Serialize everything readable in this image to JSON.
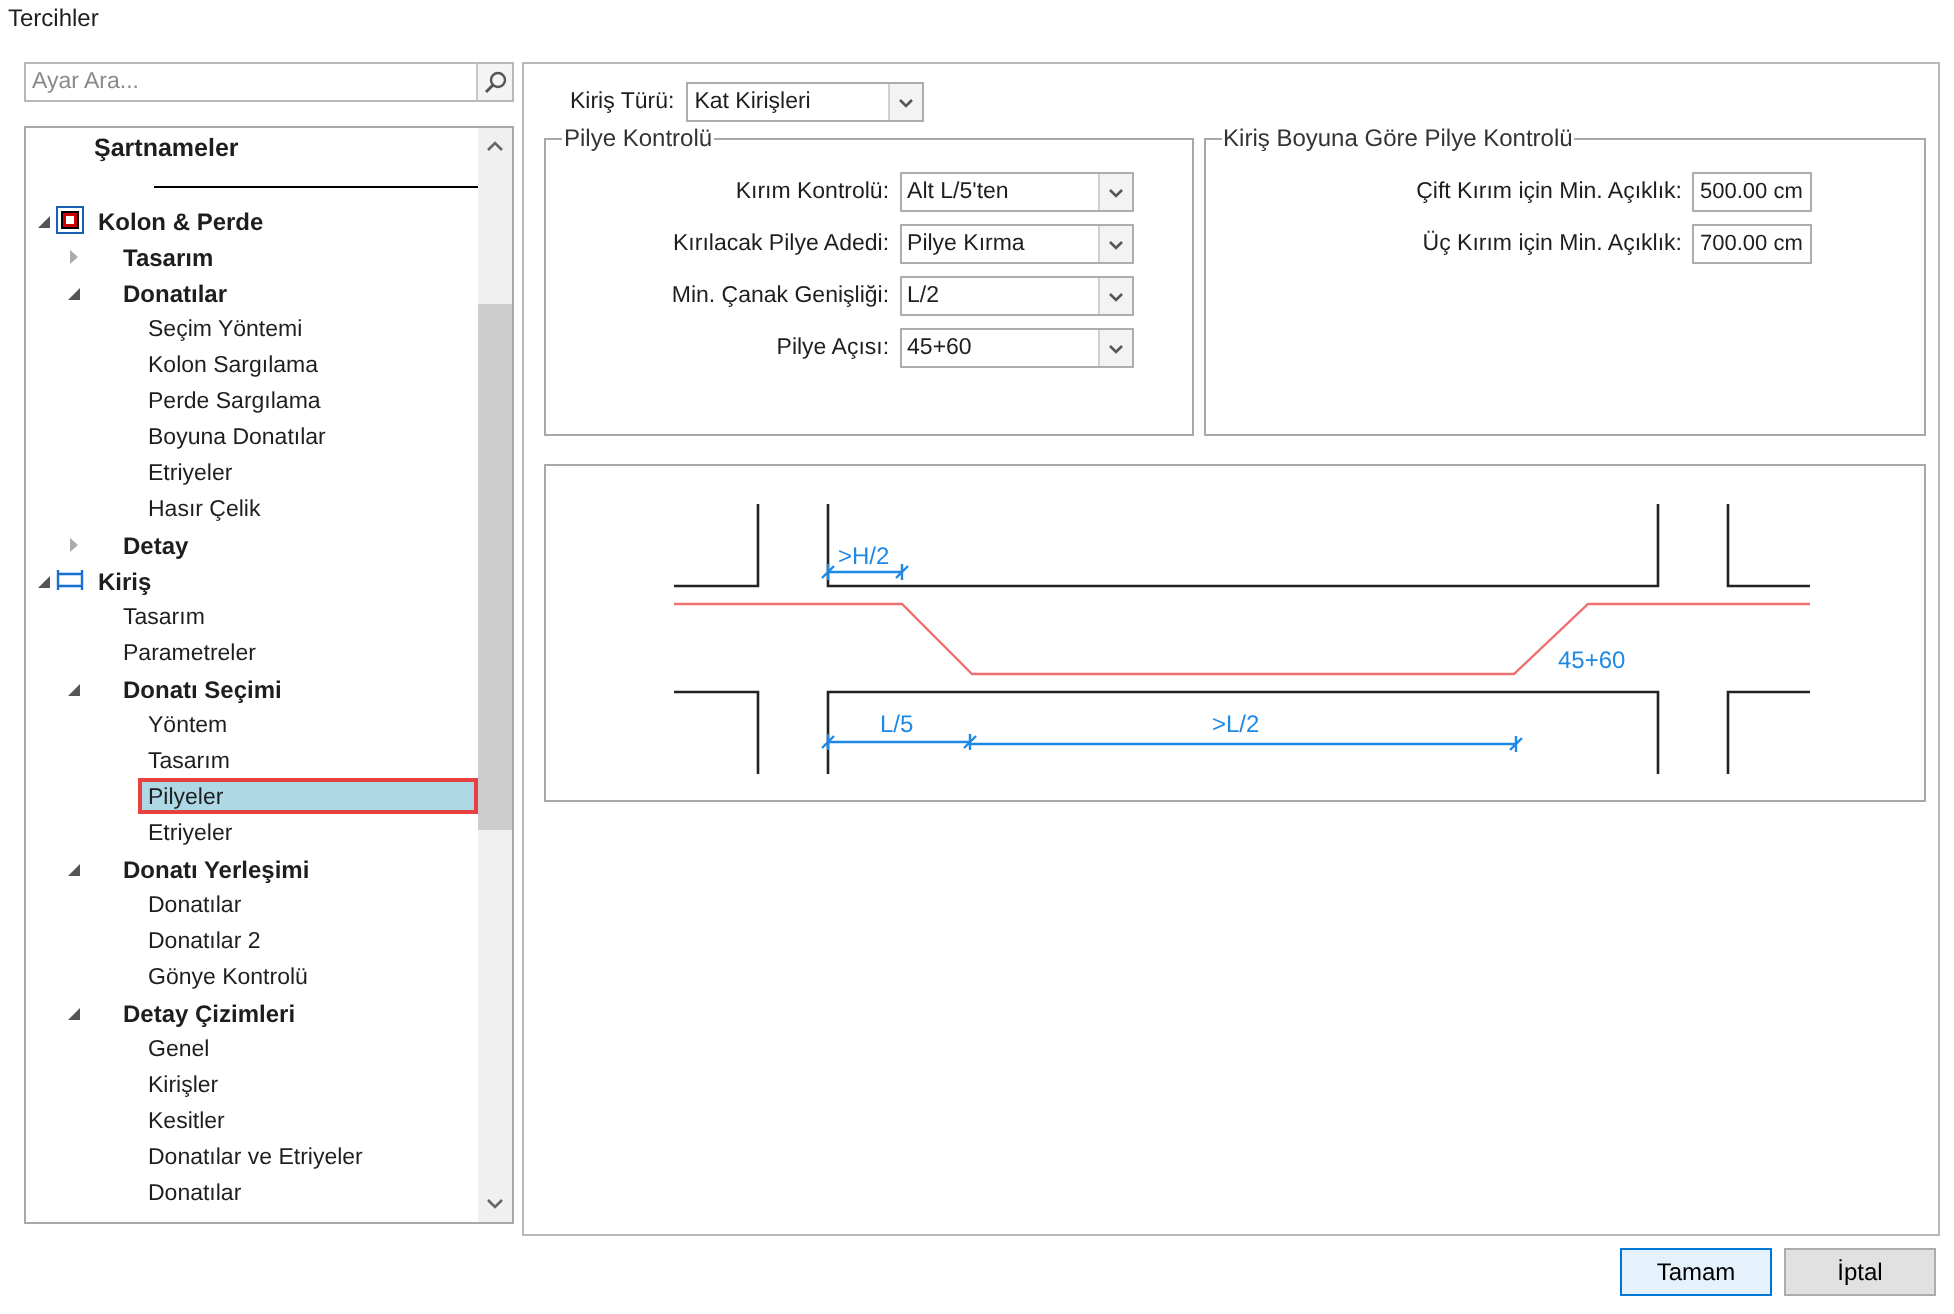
{
  "window": {
    "title": "Tercihler"
  },
  "search": {
    "placeholder": "Ayar Ara..."
  },
  "tree": {
    "header": "Şartnameler",
    "items": [
      {
        "label": "Kolon & Perde",
        "bold": true,
        "expanded": true,
        "kind": "column",
        "selected": false,
        "children": [
          {
            "label": "Tasarım",
            "bold": true,
            "expanded": false,
            "selected": false
          },
          {
            "label": "Donatılar",
            "bold": true,
            "expanded": true,
            "selected": false,
            "children": [
              {
                "label": "Seçim Yöntemi",
                "selected": false
              },
              {
                "label": "Kolon Sargılama",
                "selected": false
              },
              {
                "label": "Perde Sargılama",
                "selected": false
              },
              {
                "label": "Boyuna Donatılar",
                "selected": false
              },
              {
                "label": "Etriyeler",
                "selected": false
              },
              {
                "label": "Hasır Çelik",
                "selected": false
              }
            ]
          },
          {
            "label": "Detay",
            "bold": true,
            "expanded": false,
            "selected": false
          }
        ]
      },
      {
        "label": "Kiriş",
        "bold": true,
        "expanded": true,
        "kind": "beam",
        "selected": false,
        "children": [
          {
            "label": "Tasarım",
            "selected": false
          },
          {
            "label": "Parametreler",
            "selected": false
          },
          {
            "label": "Donatı Seçimi",
            "bold": true,
            "expanded": true,
            "selected": false,
            "children": [
              {
                "label": "Yöntem",
                "selected": false
              },
              {
                "label": "Tasarım",
                "selected": false
              },
              {
                "label": "Pilyeler",
                "selected": true
              },
              {
                "label": "Etriyeler",
                "selected": false
              }
            ]
          },
          {
            "label": "Donatı Yerleşimi",
            "bold": true,
            "expanded": true,
            "selected": false,
            "children": [
              {
                "label": "Donatılar",
                "selected": false
              },
              {
                "label": "Donatılar 2",
                "selected": false
              },
              {
                "label": "Gönye Kontrolü",
                "selected": false
              }
            ]
          },
          {
            "label": "Detay Çizimleri",
            "bold": true,
            "expanded": true,
            "selected": false,
            "children": [
              {
                "label": "Genel",
                "selected": false
              },
              {
                "label": "Kirişler",
                "selected": false
              },
              {
                "label": "Kesitler",
                "selected": false
              },
              {
                "label": "Donatılar ve Etriyeler",
                "selected": false
              },
              {
                "label": "Donatılar",
                "selected": false
              }
            ]
          }
        ]
      }
    ]
  },
  "beam_type": {
    "label": "Kiriş Türü:",
    "value": "Kat Kirişleri"
  },
  "pilye_control": {
    "title": "Pilye Kontrolü",
    "fields": [
      {
        "label": "Kırım Kontrolü:",
        "value": "Alt L/5'ten"
      },
      {
        "label": "Kırılacak Pilye Adedi:",
        "value": "Pilye Kırma"
      },
      {
        "label": "Min. Çanak Genişliği:",
        "value": "L/2"
      },
      {
        "label": "Pilye Açısı:",
        "value": "45+60"
      }
    ]
  },
  "length_control": {
    "title": "Kiriş Boyuna Göre Pilye Kontrolü",
    "fields": [
      {
        "label": "Çift Kırım için Min. Açıklık:",
        "value": "500.00 cm"
      },
      {
        "label": "Üç Kırım için Min. Açıklık:",
        "value": "700.00 cm"
      }
    ]
  },
  "diagram": {
    "support_dim": ">H/2",
    "end_dim": "L/5",
    "middle_dim": ">L/2",
    "angle": "45+60"
  },
  "buttons": [
    {
      "label": "Tamam",
      "kind": "primary"
    },
    {
      "label": "İptal",
      "kind": "normal"
    }
  ]
}
